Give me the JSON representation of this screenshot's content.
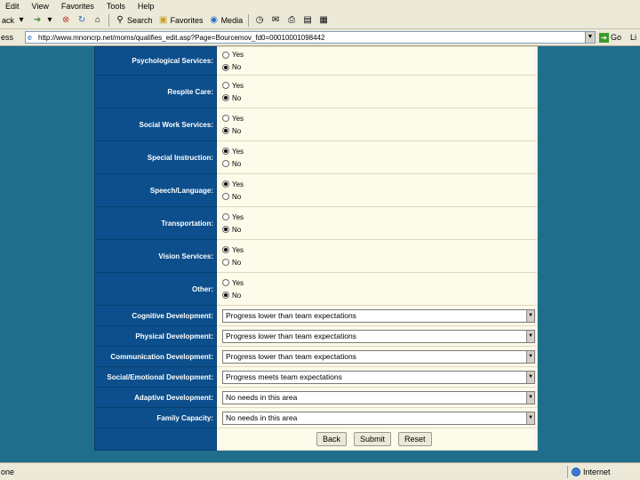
{
  "menu": [
    "Edit",
    "View",
    "Favorites",
    "Tools",
    "Help"
  ],
  "toolbar": {
    "back_label": "ack",
    "search_label": "Search",
    "favorites_label": "Favorites",
    "media_label": "Media"
  },
  "address": {
    "label": "ess",
    "url": "http://www.mnoncrp.net/moms/qualifies_edit.asp?Page=Bourcemov_fd0=00010001098442",
    "go_label": "Go",
    "links_label": "Li"
  },
  "form": {
    "radio_rows": [
      {
        "label": "Psychological Services:",
        "selected": "No",
        "options": [
          "Yes",
          "No"
        ]
      },
      {
        "label": "Respite Care:",
        "selected": "No",
        "options": [
          "Yes",
          "No"
        ]
      },
      {
        "label": "Social Work Services:",
        "selected": "No",
        "options": [
          "Yes",
          "No"
        ]
      },
      {
        "label": "Special Instruction:",
        "selected": "Yes",
        "options": [
          "Yes",
          "No"
        ]
      },
      {
        "label": "Speech/Language:",
        "selected": "Yes",
        "options": [
          "Yes",
          "No"
        ]
      },
      {
        "label": "Transportation:",
        "selected": "No",
        "options": [
          "Yes",
          "No"
        ]
      },
      {
        "label": "Vision Services:",
        "selected": "Yes",
        "options": [
          "Yes",
          "No"
        ]
      },
      {
        "label": "Other:",
        "selected": "No",
        "options": [
          "Yes",
          "No"
        ]
      }
    ],
    "select_rows": [
      {
        "label": "Cognitive Development:",
        "value": "Progress lower than team expectations"
      },
      {
        "label": "Physical Development:",
        "value": "Progress lower than team expectations"
      },
      {
        "label": "Communication Development:",
        "value": "Progress lower than team expectations"
      },
      {
        "label": "Social/Emotional Development:",
        "value": "Progress meets team expectations"
      },
      {
        "label": "Adaptive Development:",
        "value": "No needs in this area"
      },
      {
        "label": "Family Capacity:",
        "value": "No needs in this area"
      }
    ],
    "buttons": {
      "back": "Back",
      "submit": "Submit",
      "reset": "Reset"
    }
  },
  "status": {
    "left": "one",
    "zone": "Internet"
  },
  "colors": {
    "page_bg": "#1f6e8c",
    "label_bg": "#0c4f8c",
    "field_bg": "#fdfbe9",
    "chrome": "#ece9d8"
  }
}
